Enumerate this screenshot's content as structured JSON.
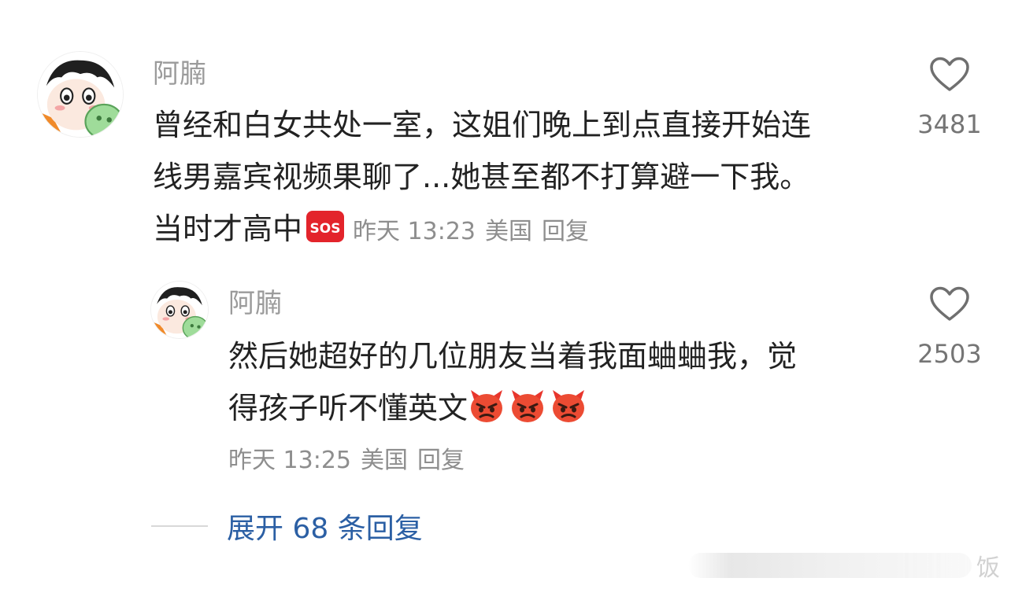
{
  "comment": {
    "username": "阿腩",
    "text_lines": [
      "曾经和白女共处一室，这姐们晚上到点直接开始连",
      "线男嘉宾视频果聊了...她甚至都不打算避一下我。",
      "当时才高中"
    ],
    "emoji": "sos-emoji",
    "time": "昨天 13:23",
    "location": "美国",
    "reply_label": "回复",
    "like_count": "3481",
    "like_icon": "heart-outline-icon"
  },
  "reply": {
    "username": "阿腩",
    "text_lines": [
      "然后她超好的几位朋友当着我面蛐蛐我，觉",
      "得孩子听不懂英文"
    ],
    "emojis": [
      "angry-devil-emoji",
      "angry-devil-emoji",
      "angry-devil-emoji"
    ],
    "time": "昨天 13:25",
    "location": "美国",
    "reply_label": "回复",
    "like_count": "2503",
    "like_icon": "heart-outline-icon"
  },
  "expand": {
    "label": "展开 68 条回复"
  },
  "watermark": {
    "text": "饭"
  },
  "colors": {
    "username": "#9b9b9b",
    "text": "#222222",
    "meta": "#8e8e8e",
    "link": "#2b5fa4",
    "like_count": "#757575"
  }
}
